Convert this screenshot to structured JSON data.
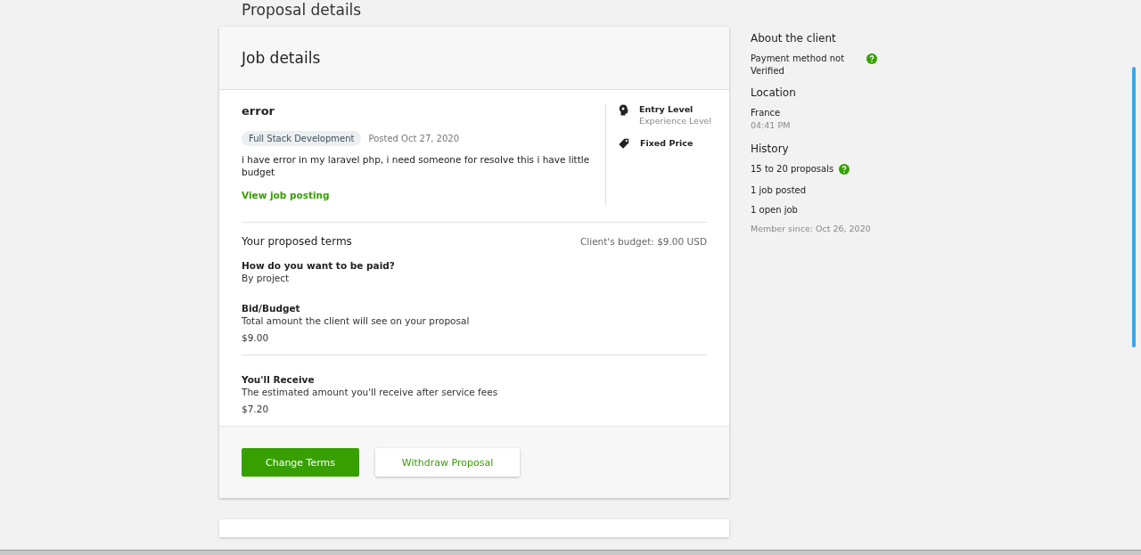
{
  "page_title": "Proposal details",
  "job": {
    "heading": "Job details",
    "title": "error",
    "category": "Full Stack Development",
    "posted": "Posted Oct 27, 2020",
    "description": "i have error in my laravel php, i need someone for resolve this i have little budget",
    "link": "View job posting",
    "features": [
      {
        "kind": "level",
        "title": "Entry Level",
        "subtitle": "Experience Level"
      },
      {
        "kind": "price",
        "title": "Fixed Price"
      }
    ]
  },
  "terms": {
    "heading": "Your proposed terms",
    "budget": "Client's budget: $9.00 USD",
    "items": [
      {
        "label": "How do you want to be paid?",
        "value": "By project"
      },
      {
        "label": "Bid/Budget",
        "description": "Total amount the client will see on your proposal",
        "value": "$9.00"
      },
      {
        "label": "You'll Receive",
        "description": "The estimated amount you'll receive after service fees",
        "value": "$7.20"
      }
    ]
  },
  "buttons": [
    {
      "kind": "primary",
      "label": "Change Terms"
    },
    {
      "kind": "secondary",
      "label": "Withdraw Proposal"
    }
  ],
  "client": {
    "heading": "About the client",
    "payment": "Payment method not Verified",
    "location_heading": "Location",
    "country": "France",
    "time": "04:41 PM",
    "history_heading": "History",
    "proposals": "15 to 20 proposals",
    "jobs_posted": "1 job posted",
    "open_jobs": "1 open job",
    "member_since": "Member since: Oct 26, 2020"
  }
}
